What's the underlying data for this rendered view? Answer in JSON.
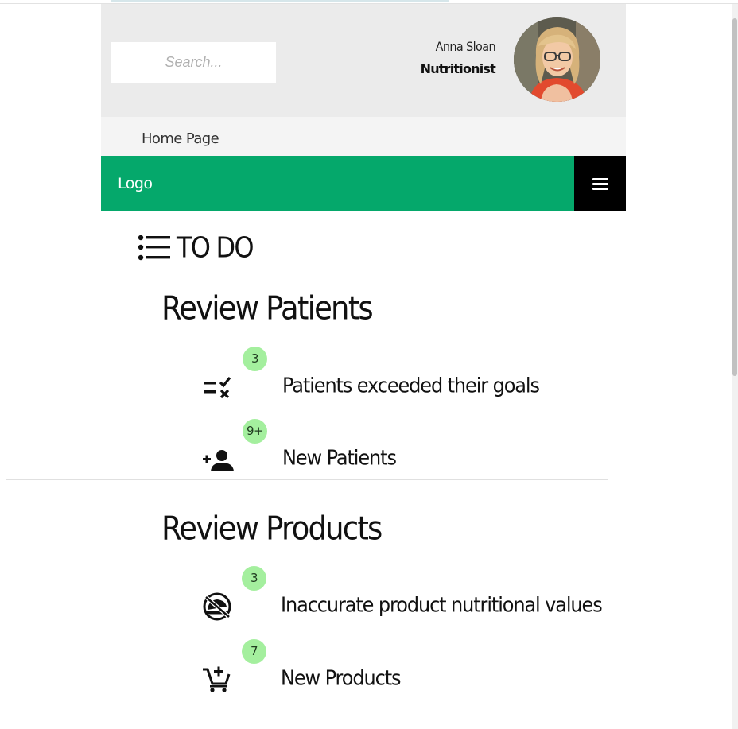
{
  "header": {
    "search_placeholder": "Search...",
    "user_name": "Anna Sloan",
    "user_role": "Nutritionist"
  },
  "breadcrumb": {
    "current": "Home Page"
  },
  "navbar": {
    "logo": "Logo",
    "menu_icon": "hamburger-menu-icon"
  },
  "todo": {
    "icon": "list-icon",
    "title": "TO DO",
    "sections": [
      {
        "title": "Review Patients",
        "items": [
          {
            "icon": "rule-check-icon",
            "badge": "3",
            "label": "Patients exceeded their goals"
          },
          {
            "icon": "person-add-icon",
            "badge": "9+",
            "label": "New Patients"
          }
        ]
      },
      {
        "title": "Review Products",
        "items": [
          {
            "icon": "no-food-icon",
            "badge": "3",
            "label": "Inaccurate product nutritional values"
          },
          {
            "icon": "add-shopping-cart-icon",
            "badge": "7",
            "label": "New Products"
          }
        ]
      }
    ]
  },
  "colors": {
    "brand_green": "#05a86b",
    "badge_green": "#a4ef9e",
    "header_bg": "#ebebeb"
  }
}
